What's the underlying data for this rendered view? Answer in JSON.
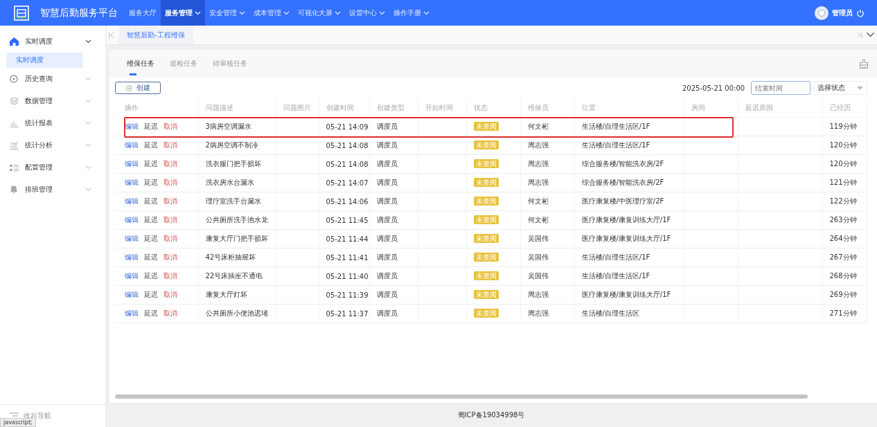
{
  "header": {
    "title": "智慧后勤服务平台",
    "nav": [
      {
        "label": "服务大厅",
        "selected": false,
        "dropdown": false
      },
      {
        "label": "服务管理",
        "selected": true,
        "dropdown": true
      },
      {
        "label": "安全管理",
        "selected": false,
        "dropdown": true
      },
      {
        "label": "成本管理",
        "selected": false,
        "dropdown": true
      },
      {
        "label": "可视化大屏",
        "selected": false,
        "dropdown": true
      },
      {
        "label": "设置中心",
        "selected": false,
        "dropdown": true
      },
      {
        "label": "操作手册",
        "selected": false,
        "dropdown": true
      }
    ],
    "user": "管理员"
  },
  "sidebar": {
    "items": [
      {
        "label": "实时调度",
        "expanded": true,
        "children": [
          {
            "label": "实时调度",
            "selected": true
          }
        ]
      },
      {
        "label": "历史查询",
        "expanded": false
      },
      {
        "label": "数据管理",
        "expanded": false
      },
      {
        "label": "统计报表",
        "expanded": false
      },
      {
        "label": "统计分析",
        "expanded": false
      },
      {
        "label": "配置管理",
        "expanded": false
      },
      {
        "label": "排班管理",
        "expanded": false
      }
    ],
    "collapse_label": "收起导航"
  },
  "page_tabs": [
    {
      "label": "智慧后勤-工程维保",
      "selected": true
    }
  ],
  "task_tabs": [
    {
      "label": "维保任务",
      "selected": true
    },
    {
      "label": "巡检任务",
      "selected": false
    },
    {
      "label": "待审核任务",
      "selected": false
    }
  ],
  "create_button": "创建",
  "filters": {
    "start_time": "2025-05-21 00:00",
    "end_time_placeholder": "结束时间",
    "status_placeholder": "选择状态"
  },
  "table": {
    "columns": [
      "操作",
      "问题描述",
      "问题图片",
      "创建时间",
      "创建类型",
      "开始时间",
      "状态",
      "维修员",
      "位置",
      "房间",
      "延迟原因",
      "已经历"
    ],
    "rows": [
      {
        "actions": [
          "编辑",
          "延迟",
          "取消"
        ],
        "description": "3病房空调漏水",
        "created": "05-21 14:09",
        "type": "调度员",
        "status": "未查阅",
        "repairer": "何文彬",
        "location": "生活楼/自理生活区/1F",
        "elapsed": "119分钟",
        "highlighted": true
      },
      {
        "actions": [
          "编辑",
          "延迟",
          "取消"
        ],
        "description": "2病房空调不制冷",
        "created": "05-21 14:08",
        "type": "调度员",
        "status": "未查阅",
        "repairer": "周志强",
        "location": "生活楼/自理生活区/1F",
        "elapsed": "120分钟",
        "highlighted": false
      },
      {
        "actions": [
          "编辑",
          "延迟",
          "取消"
        ],
        "description": "洗衣服门把手损坏",
        "created": "05-21 14:08",
        "type": "调度员",
        "status": "未查阅",
        "repairer": "周志强",
        "location": "综合服务楼/智能洗衣房/2F",
        "elapsed": "120分钟",
        "highlighted": false
      },
      {
        "actions": [
          "编辑",
          "延迟",
          "取消"
        ],
        "description": "洗衣房水台漏水",
        "created": "05-21 14:07",
        "type": "调度员",
        "status": "未查阅",
        "repairer": "周志强",
        "location": "综合服务楼/智能洗衣房/2F",
        "elapsed": "121分钟",
        "highlighted": false
      },
      {
        "actions": [
          "编辑",
          "延迟",
          "取消"
        ],
        "description": "理疗室洗手台漏水",
        "created": "05-21 14:06",
        "type": "调度员",
        "status": "未查阅",
        "repairer": "何文彬",
        "location": "医疗康复楼/中医理疗室/2F",
        "elapsed": "122分钟",
        "highlighted": false
      },
      {
        "actions": [
          "编辑",
          "延迟",
          "取消"
        ],
        "description": "公共厕所洗手池水龙",
        "created": "05-21 11:45",
        "type": "调度员",
        "status": "未查阅",
        "repairer": "何文彬",
        "location": "医疗康复楼/康复训练大厅/1F",
        "elapsed": "263分钟",
        "highlighted": false
      },
      {
        "actions": [
          "编辑",
          "延迟",
          "取消"
        ],
        "description": "康复大厅门把手损坏",
        "created": "05-21 11:44",
        "type": "调度员",
        "status": "未查阅",
        "repairer": "吴国伟",
        "location": "医疗康复楼/康复训练大厅/1F",
        "elapsed": "264分钟",
        "highlighted": false
      },
      {
        "actions": [
          "编辑",
          "延迟",
          "取消"
        ],
        "description": "42号床柜抽屉坏",
        "created": "05-21 11:41",
        "type": "调度员",
        "status": "未查阅",
        "repairer": "吴国伟",
        "location": "生活楼/自理生活区/1F",
        "elapsed": "267分钟",
        "highlighted": false
      },
      {
        "actions": [
          "编辑",
          "延迟",
          "取消"
        ],
        "description": "22号床插座不通电",
        "created": "05-21 11:40",
        "type": "调度员",
        "status": "未查阅",
        "repairer": "吴国伟",
        "location": "生活楼/自理生活区/1F",
        "elapsed": "268分钟",
        "highlighted": false
      },
      {
        "actions": [
          "编辑",
          "延迟",
          "取消"
        ],
        "description": "康复大厅灯坏",
        "created": "05-21 11:39",
        "type": "调度员",
        "status": "未查阅",
        "repairer": "周志强",
        "location": "医疗康复楼/康复训练大厅/1F",
        "elapsed": "269分钟",
        "highlighted": false
      },
      {
        "actions": [
          "编辑",
          "延迟",
          "取消"
        ],
        "description": "公共厕所小便池迟堵",
        "created": "05-21 11:37",
        "type": "调度员",
        "status": "未查阅",
        "repairer": "周志强",
        "location": "生活楼/自理生活区",
        "elapsed": "271分钟",
        "highlighted": false
      }
    ]
  },
  "footer": "蜀ICP备19034998号",
  "browser_status": "javascript;"
}
